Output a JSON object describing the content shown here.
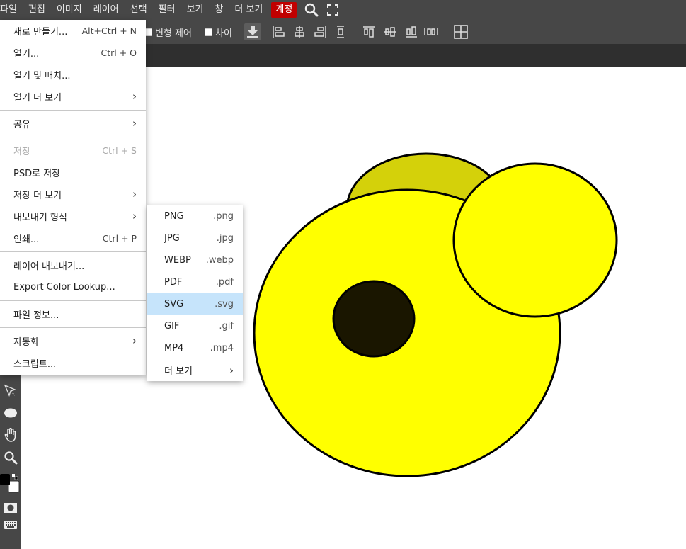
{
  "menubar": {
    "items": [
      "파일",
      "편집",
      "이미지",
      "레이어",
      "선택",
      "필터",
      "보기",
      "창",
      "더 보기"
    ],
    "account_label": "계정",
    "search_icon": "search-icon",
    "fullscreen_icon": "fullscreen-icon",
    "account_color": "#c00000"
  },
  "optionsbar": {
    "transform_label": "변형 제어",
    "diff_label": "차이"
  },
  "file_menu": {
    "items": [
      {
        "label": "새로 만들기...",
        "shortcut": "Alt+Ctrl + N"
      },
      {
        "label": "열기...",
        "shortcut": "Ctrl + O"
      },
      {
        "label": "열기 및 배치..."
      },
      {
        "label": "열기 더 보기",
        "submenu": true
      },
      {
        "label": "공유",
        "submenu": true
      },
      {
        "label": "저장",
        "shortcut": "Ctrl + S",
        "disabled": true
      },
      {
        "label": "PSD로 저장"
      },
      {
        "label": "저장 더 보기",
        "submenu": true
      },
      {
        "label": "내보내기 형식",
        "submenu": true
      },
      {
        "label": "인쇄...",
        "shortcut": "Ctrl + P"
      },
      {
        "label": "레이어 내보내기..."
      },
      {
        "label": "Export Color Lookup..."
      },
      {
        "label": "파일 정보..."
      },
      {
        "label": "자동화",
        "submenu": true
      },
      {
        "label": "스크립트..."
      }
    ],
    "chevron": "›"
  },
  "export_submenu": {
    "items": [
      {
        "label": "PNG",
        "ext": ".png"
      },
      {
        "label": "JPG",
        "ext": ".jpg"
      },
      {
        "label": "WEBP",
        "ext": ".webp"
      },
      {
        "label": "PDF",
        "ext": ".pdf"
      },
      {
        "label": "SVG",
        "ext": ".svg",
        "highlighted": true
      },
      {
        "label": "GIF",
        "ext": ".gif"
      },
      {
        "label": "MP4",
        "ext": ".mp4"
      },
      {
        "label": "더 보기",
        "ext": "›"
      }
    ],
    "highlight_color": "#c6e4fb"
  },
  "canvas": {
    "background": "#ffffff",
    "shape_colors": {
      "yellow": "#ffff00",
      "olive": "#d4d10a",
      "dark": "#1a1600",
      "stroke": "#000000"
    }
  },
  "tools": [
    "select-icon",
    "ellipse-icon",
    "hand-icon",
    "zoom-icon",
    "color-swatch-icon",
    "mask-icon",
    "keyboard-icon"
  ]
}
